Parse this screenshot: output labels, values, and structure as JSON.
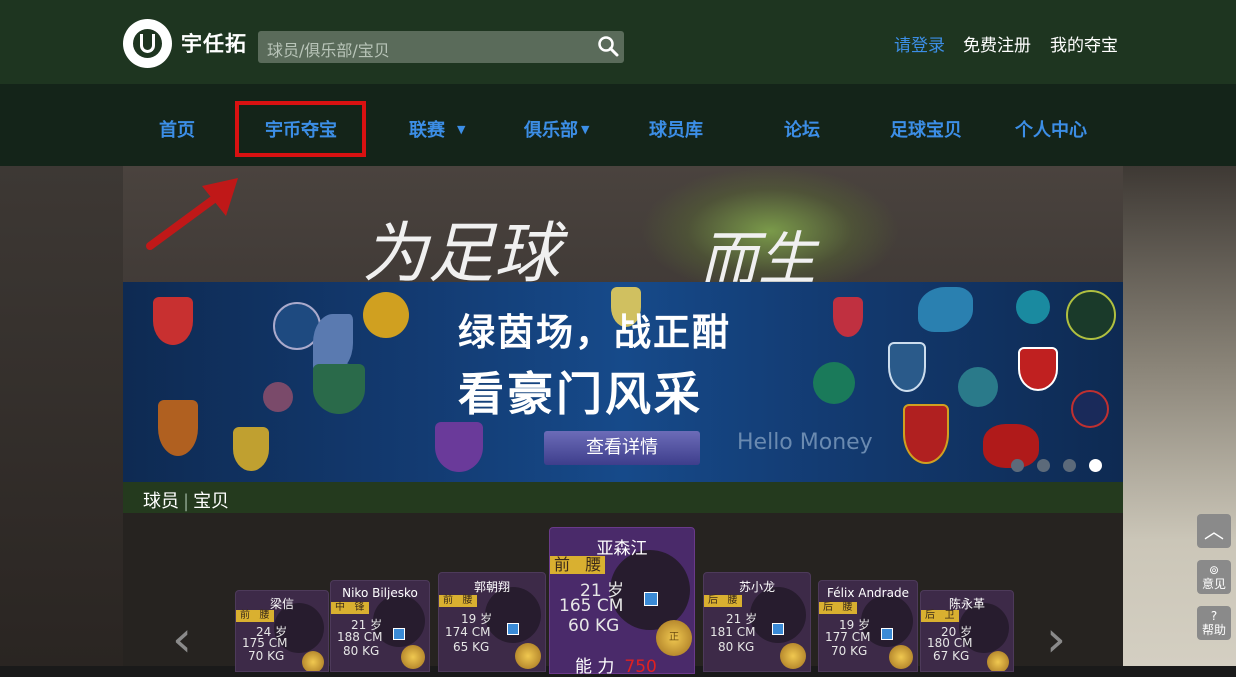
{
  "brand": {
    "name": "宇任拓"
  },
  "search": {
    "placeholder": "球员/俱乐部/宝贝"
  },
  "account": {
    "login": "请登录",
    "register": "免费注册",
    "my_treasure": "我的夺宝"
  },
  "nav": {
    "items": [
      "首页",
      "宇币夺宝",
      "联赛",
      "俱乐部",
      "球员库",
      "论坛",
      "足球宝贝",
      "个人中心"
    ],
    "highlighted": "宇币夺宝",
    "dropdowns": [
      "联赛",
      "俱乐部"
    ]
  },
  "hero": {
    "slogan_1": "为足球",
    "slogan_2": "而生"
  },
  "banner": {
    "line1": "绿茵场，战正酣",
    "line2": "看豪门风采",
    "button": "查看详情",
    "sponsor": "Hello Money",
    "slide_count": 4,
    "active_slide": 4
  },
  "section": {
    "tab1": "球员",
    "tab2": "宝贝"
  },
  "players": {
    "main": {
      "name": "亚森江",
      "pos_a": "前",
      "pos_b": "腰",
      "age": "21 岁",
      "height": "165 CM",
      "weight": "60  KG",
      "ability_label": "能  力",
      "ability_value": "750",
      "badge": "正"
    },
    "p1": {
      "name": "梁信",
      "pos_a": "前",
      "pos_b": "腰",
      "age": "24 岁",
      "height": "175 CM",
      "weight": "70  KG"
    },
    "p2": {
      "name": "Niko Biljesko",
      "pos_a": "中",
      "pos_b": "锋",
      "age": "21 岁",
      "height": "188 CM",
      "weight": "80  KG"
    },
    "p3": {
      "name": "郭朝翔",
      "pos_a": "前",
      "pos_b": "腰",
      "age": "19 岁",
      "height": "174 CM",
      "weight": "65  KG"
    },
    "p4": {
      "name": "苏小龙",
      "pos_a": "后",
      "pos_b": "腰",
      "age": "21 岁",
      "height": "181 CM",
      "weight": "80  KG"
    },
    "p5": {
      "name": "Félix Andrade",
      "pos_a": "后",
      "pos_b": "腰",
      "age": "19 岁",
      "height": "177 CM",
      "weight": "70  KG"
    },
    "p6": {
      "name": "陈永革",
      "pos_a": "后",
      "pos_b": "卫",
      "age": "20 岁",
      "height": "180 CM",
      "weight": "67  KG"
    }
  },
  "side": {
    "feedback": "意见",
    "help": "帮助"
  },
  "icons": {
    "search": "search-icon",
    "scroll_top": "chevron-up-icon",
    "feedback": "paperclip-icon",
    "help": "question-icon"
  },
  "colors": {
    "topbar": "#1e3520",
    "nav_link": "#3c8ee6",
    "highlight": "#d91111",
    "ability": "#e02020"
  }
}
